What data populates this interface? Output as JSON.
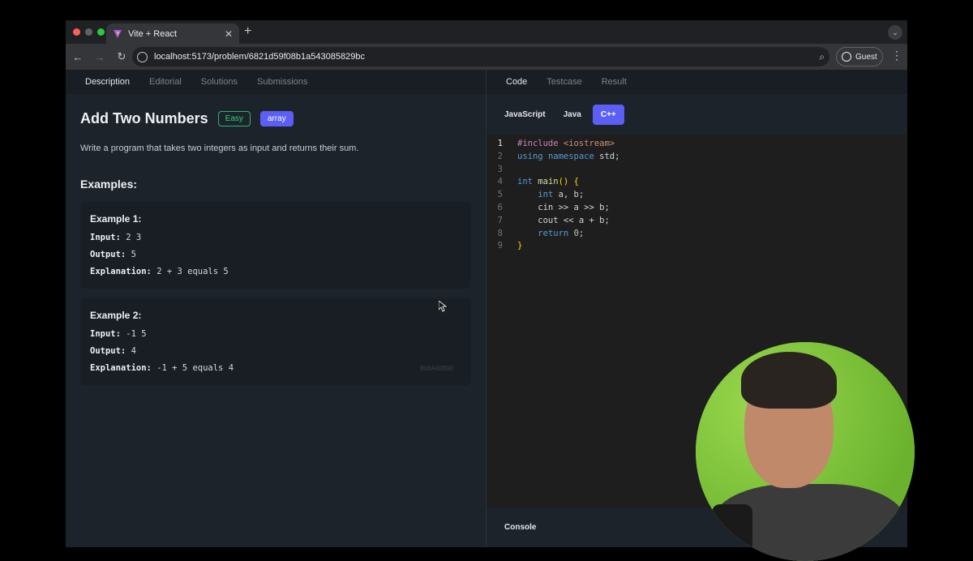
{
  "browser": {
    "tab_title": "Vite + React",
    "close_glyph": "✕",
    "new_tab_glyph": "+",
    "url": "localhost:5173/problem/6821d59f08b1a543085829bc",
    "profile_label": "Guest"
  },
  "left_panel": {
    "tabs": [
      "Description",
      "Editorial",
      "Solutions",
      "Submissions"
    ],
    "active_tab": "Description",
    "problem": {
      "title": "Add Two Numbers",
      "difficulty": "Easy",
      "tag": "array",
      "statement": "Write a program that takes two integers as input and returns their sum."
    },
    "examples_heading": "Examples:",
    "examples": [
      {
        "heading": "Example 1:",
        "input_label": "Input:",
        "input": "2 3",
        "output_label": "Output:",
        "output": "5",
        "explanation_label": "Explanation:",
        "explanation": "2 + 3 equals 5"
      },
      {
        "heading": "Example 2:",
        "input_label": "Input:",
        "input": "-1 5",
        "output_label": "Output:",
        "output": "4",
        "explanation_label": "Explanation:",
        "explanation": "-1 + 5 equals 4"
      }
    ],
    "watermark": "808A40890"
  },
  "right_panel": {
    "tabs": [
      "Code",
      "Testcase",
      "Result"
    ],
    "active_tab": "Code",
    "languages": [
      "JavaScript",
      "Java",
      "C++"
    ],
    "active_language": "C++",
    "code_lines": [
      "#include <iostream>",
      "using namespace std;",
      "",
      "int main() {",
      "    int a, b;",
      "    cin >> a >> b;",
      "    cout << a + b;",
      "    return 0;",
      "}"
    ],
    "console_label": "Console"
  },
  "colors": {
    "accent": "#5b5ff5",
    "easy": "#2bd383",
    "panel_bg": "#1d232a",
    "editor_bg": "#1e1e1e"
  }
}
